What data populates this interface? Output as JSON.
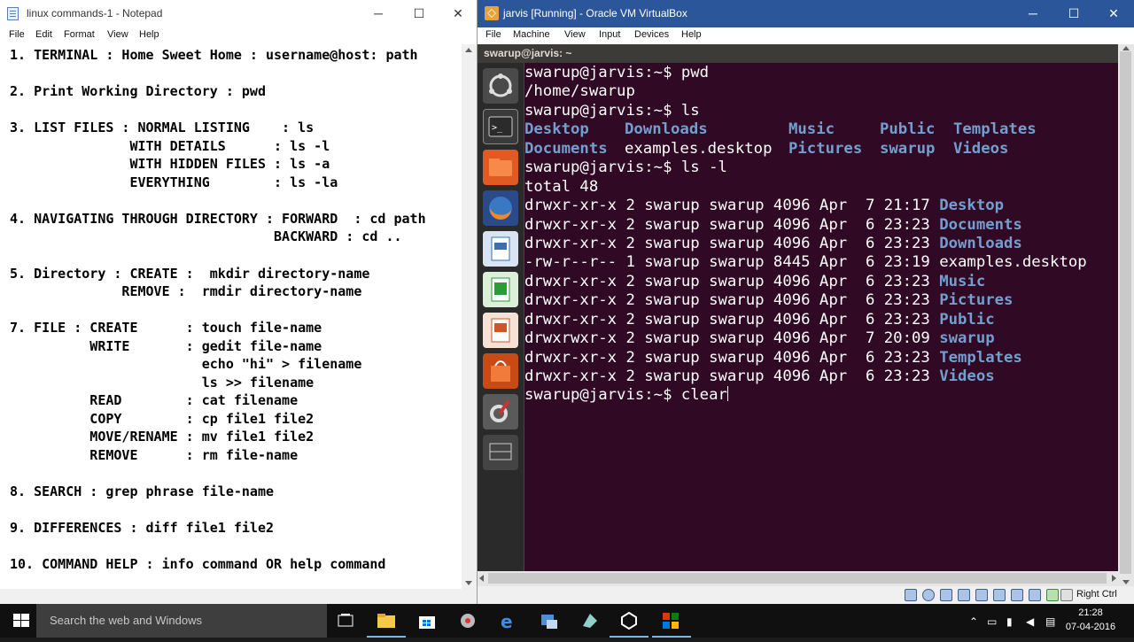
{
  "notepad": {
    "title": "linux commands-1 - Notepad",
    "controls": {
      "minimize": "─",
      "maximize": "☐",
      "close": "✕"
    },
    "menu": [
      "File",
      "Edit",
      "Format",
      "View",
      "Help"
    ],
    "content": "1. TERMINAL : Home Sweet Home : username@host: path\n\n2. Print Working Directory : pwd\n\n3. LIST FILES : NORMAL LISTING    : ls\n               WITH DETAILS      : ls -l\n               WITH HIDDEN FILES : ls -a\n               EVERYTHING        : ls -la\n\n4. NAVIGATING THROUGH DIRECTORY : FORWARD  : cd path\n                                 BACKWARD : cd ..\n\n5. Directory : CREATE :  mkdir directory-name\n              REMOVE :  rmdir directory-name\n\n7. FILE : CREATE      : touch file-name\n          WRITE       : gedit file-name\n                        echo \"hi\" > filename\n                        ls >> filename\n          READ        : cat filename\n          COPY        : cp file1 file2\n          MOVE/RENAME : mv file1 file2\n          REMOVE      : rm file-name\n\n8. SEARCH : grep phrase file-name\n\n9. DIFFERENCES : diff file1 file2\n\n10. COMMAND HELP : info command OR help command"
  },
  "vbox": {
    "title": "jarvis [Running] - Oracle VM VirtualBox",
    "controls": {
      "minimize": "─",
      "maximize": "☐",
      "close": "✕"
    },
    "menu": [
      "File",
      "Machine",
      "View",
      "Input",
      "Devices",
      "Help"
    ],
    "vm_window_title": "swarup@jarvis: ~",
    "host_key": "Right Ctrl",
    "launcher_icons": [
      "ubuntu-dash-icon",
      "terminal-icon",
      "files-icon",
      "firefox-icon",
      "writer-icon",
      "calc-icon",
      "impress-icon",
      "software-center-icon",
      "system-settings-icon",
      "workspace-switcher-icon"
    ]
  },
  "terminal": {
    "l1": "swarup@jarvis:~$ pwd",
    "l2": "/home/swarup",
    "l3": "swarup@jarvis:~$ ls",
    "ls_cols": [
      [
        "Desktop",
        "Documents"
      ],
      [
        "Downloads",
        "examples.desktop"
      ],
      [
        "Music",
        "Pictures"
      ],
      [
        "Public",
        "swarup"
      ],
      [
        "Templates",
        "Videos"
      ]
    ],
    "l6": "swarup@jarvis:~$ ls -l",
    "l7": "total 48",
    "listing": [
      {
        "perm": "drwxr-xr-x 2 swarup swarup 4096 Apr  7 21:17 ",
        "name": "Desktop",
        "dir": true
      },
      {
        "perm": "drwxr-xr-x 2 swarup swarup 4096 Apr  6 23:23 ",
        "name": "Documents",
        "dir": true
      },
      {
        "perm": "drwxr-xr-x 2 swarup swarup 4096 Apr  6 23:23 ",
        "name": "Downloads",
        "dir": true
      },
      {
        "perm": "-rw-r--r-- 1 swarup swarup 8445 Apr  6 23:19 ",
        "name": "examples.desktop",
        "dir": false
      },
      {
        "perm": "drwxr-xr-x 2 swarup swarup 4096 Apr  6 23:23 ",
        "name": "Music",
        "dir": true
      },
      {
        "perm": "drwxr-xr-x 2 swarup swarup 4096 Apr  6 23:23 ",
        "name": "Pictures",
        "dir": true
      },
      {
        "perm": "drwxr-xr-x 2 swarup swarup 4096 Apr  6 23:23 ",
        "name": "Public",
        "dir": true
      },
      {
        "perm": "drwxrwxr-x 2 swarup swarup 4096 Apr  7 20:09 ",
        "name": "swarup",
        "dir": true
      },
      {
        "perm": "drwxr-xr-x 2 swarup swarup 4096 Apr  6 23:23 ",
        "name": "Templates",
        "dir": true
      },
      {
        "perm": "drwxr-xr-x 2 swarup swarup 4096 Apr  6 23:23 ",
        "name": "Videos",
        "dir": true
      }
    ],
    "prompt_last": "swarup@jarvis:~$ ",
    "typed": "clear",
    "colors": {
      "background": "#300a24",
      "text": "#ffffff",
      "directory": "#729fcf"
    }
  },
  "taskbar": {
    "search_placeholder": "Search the web and Windows",
    "time": "21:28",
    "date": "07-04-2016",
    "pinned": [
      "task-view-icon",
      "file-explorer-icon",
      "store-icon",
      "network-app-icon",
      "edge-icon",
      "media-icon",
      "app-icon",
      "virtualbox-icon",
      "office-icon"
    ]
  }
}
